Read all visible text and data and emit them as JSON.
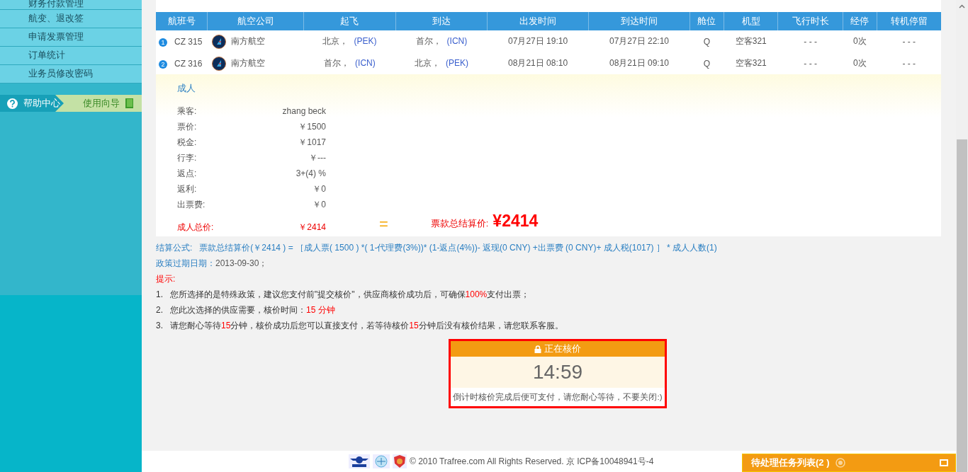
{
  "sidebar": {
    "items": [
      {
        "label": "财务付款管理"
      },
      {
        "label": "航变、退改签"
      },
      {
        "label": "申请发票管理"
      },
      {
        "label": "订单统计"
      },
      {
        "label": "业务员修改密码"
      }
    ],
    "help": {
      "label": "帮助中心",
      "guide": "使用向导"
    }
  },
  "flights": {
    "columns": [
      "航班号",
      "航空公司",
      "起飞",
      "到达",
      "出发时间",
      "到达时间",
      "舱位",
      "机型",
      "飞行时长",
      "经停",
      "转机停留"
    ],
    "rows": [
      {
        "index": "1",
        "flight": "CZ 315",
        "airline": "南方航空",
        "from_city": "北京，",
        "from_code": "(PEK)",
        "to_city": "首尔，",
        "to_code": "(ICN)",
        "depart": "07月27日 19:10",
        "arrive": "07月27日 22:10",
        "cabin": "Q",
        "aircraft": "空客321",
        "duration": "- - -",
        "stops": "0次",
        "transfer": "- - -"
      },
      {
        "index": "2",
        "flight": "CZ 316",
        "airline": "南方航空",
        "from_city": "首尔，",
        "from_code": "(ICN)",
        "to_city": "北京，",
        "to_code": "(PEK)",
        "depart": "08月21日 08:10",
        "arrive": "08月21日 09:10",
        "cabin": "Q",
        "aircraft": "空客321",
        "duration": "- - -",
        "stops": "0次",
        "transfer": "- - -"
      }
    ]
  },
  "fare": {
    "title": "成人",
    "rows": [
      {
        "label": "乘客:",
        "value": "zhang beck"
      },
      {
        "label": "票价:",
        "value": "￥1500"
      },
      {
        "label": "税金:",
        "value": "￥1017"
      },
      {
        "label": "行李:",
        "value": "￥---"
      },
      {
        "label": "返点:",
        "value": "3+(4) %"
      },
      {
        "label": "返利:",
        "value": "￥0"
      },
      {
        "label": "出票费:",
        "value": "￥0"
      }
    ],
    "total_label": "成人总价:",
    "total_value": "￥2414",
    "equals": "=",
    "grand_label": "票款总结算价:",
    "grand_value": "¥2414"
  },
  "formula": {
    "label": "结算公式:",
    "text": "票款总结算价(￥2414 ) = ［成人票( 1500 ) *( 1-代理费(3%))* (1-返点(4%))- 返现(0 CNY) +出票费 (0 CNY)+ 成人税(1017) ］ * 成人人数(1)"
  },
  "expiry": {
    "label": "政策过期日期：",
    "value": "2013-09-30；"
  },
  "tips": {
    "title": "提示:",
    "items": [
      {
        "num": "1.",
        "segments": [
          {
            "text": "您所选择的是特殊政策，建议您支付前\"提交核价\"，供应商核价成功后，可确保",
            "highlight": false
          },
          {
            "text": "100%",
            "highlight": true
          },
          {
            "text": "支付出票；",
            "highlight": false
          }
        ]
      },
      {
        "num": "2.",
        "segments": [
          {
            "text": "您此次选择的供应需要，核价时间：",
            "highlight": false
          },
          {
            "text": "15 分钟",
            "highlight": true
          }
        ]
      },
      {
        "num": "3.",
        "segments": [
          {
            "text": "请您耐心等待",
            "highlight": false
          },
          {
            "text": "15",
            "highlight": true
          },
          {
            "text": "分钟，核价成功后您可以直接支付，若等待核价",
            "highlight": false
          },
          {
            "text": "15",
            "highlight": true
          },
          {
            "text": "分钟后没有核价结果，请您联系客服。",
            "highlight": false
          }
        ]
      }
    ]
  },
  "countdown": {
    "title": "正在核价",
    "time": "14:59",
    "note": "倒计时核价完成后便可支付，请您耐心等待，不要关闭:)"
  },
  "footer": {
    "text": "© 2010 Trafree.com All Rights Reserved. 京 ICP备10048941号-4"
  },
  "task_bar": {
    "label": "待处理任务列表(2 )"
  }
}
